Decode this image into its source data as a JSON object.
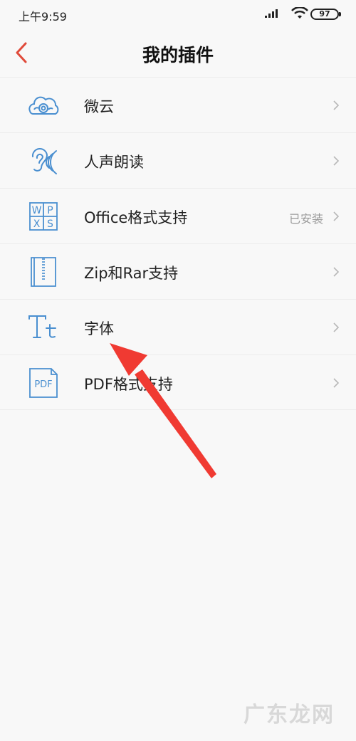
{
  "status_bar": {
    "time": "上午9:59",
    "battery": "97"
  },
  "header": {
    "title": "我的插件"
  },
  "plugins": [
    {
      "label": "微云",
      "icon": "cloud-icon",
      "status": ""
    },
    {
      "label": "人声朗读",
      "icon": "ear-icon",
      "status": ""
    },
    {
      "label": "Office格式支持",
      "icon": "office-icon",
      "status": "已安装"
    },
    {
      "label": "Zip和Rar支持",
      "icon": "zip-icon",
      "status": ""
    },
    {
      "label": "字体",
      "icon": "font-icon",
      "status": ""
    },
    {
      "label": "PDF格式支持",
      "icon": "pdf-icon",
      "status": ""
    }
  ],
  "office_icon_letters": [
    "W",
    "P",
    "X",
    "S"
  ],
  "pdf_icon_text": "PDF",
  "watermark": "广东龙网",
  "colors": {
    "accent": "#e04a3a",
    "icon_blue": "#4a8fd0",
    "arrow_red": "#f03a32"
  }
}
